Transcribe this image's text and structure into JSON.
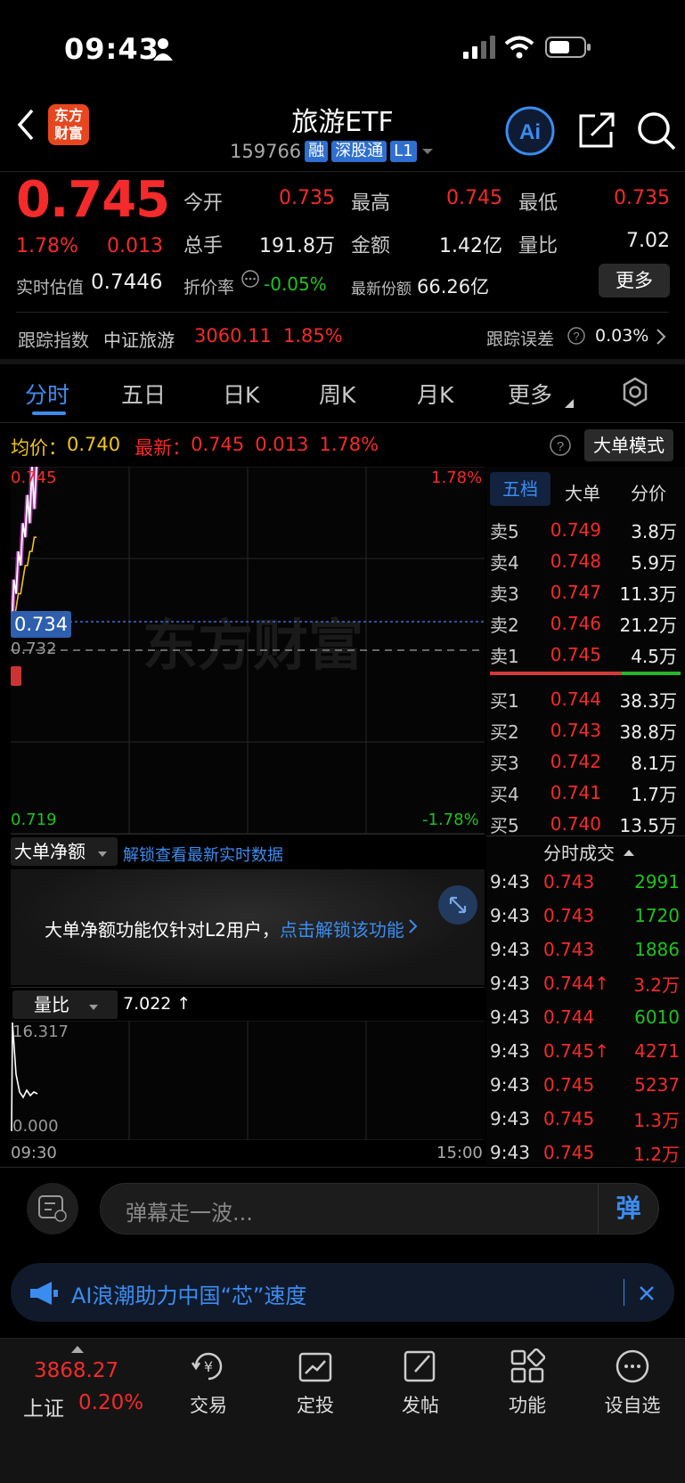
{
  "status": {
    "time": "09:43"
  },
  "header": {
    "title": "旅游ETF",
    "code": "159766",
    "tags": [
      "融",
      "深股通",
      "L1"
    ],
    "logo_text": "东方财富"
  },
  "quote": {
    "price": "0.745",
    "change_pct": "1.78%",
    "change": "0.013",
    "open_label": "今开",
    "open": "0.735",
    "high_label": "最高",
    "high": "0.745",
    "low_label": "最低",
    "low": "0.735",
    "vol_label": "总手",
    "vol": "191.8万",
    "amount_label": "金额",
    "amount": "1.42亿",
    "ratio_label": "量比",
    "ratio": "7.02",
    "iopv_label": "实时估值",
    "iopv": "0.7446",
    "discount_label": "折价率",
    "discount": "-0.05%",
    "shares_label": "最新份额",
    "shares": "66.26亿",
    "more_label": "更多"
  },
  "tracking": {
    "label": "跟踪指数",
    "index_name": "中证旅游",
    "index_value": "3060.11",
    "index_pct": "1.85%",
    "error_label": "跟踪误差",
    "error_value": "0.03%"
  },
  "tabs": [
    "分时",
    "五日",
    "日K",
    "周K",
    "月K",
    "更多"
  ],
  "chart_header": {
    "avg_label": "均价：",
    "avg": "0.740",
    "latest_label": "最新：",
    "latest": "0.745",
    "latest_chg": "0.013",
    "latest_pct": "1.78%",
    "mode_button": "大单模式"
  },
  "chart_data": {
    "type": "line",
    "y_top": "0.745",
    "y_top_pct": "1.78%",
    "y_bottom": "0.719",
    "y_bottom_pct": "-1.78%",
    "cursor_value": "0.734",
    "prev_close": "0.732",
    "x_start": "09:30",
    "x_end": "15:00",
    "ylim": [
      0.719,
      0.745
    ],
    "series": [
      {
        "values": [
          0.733,
          0.737,
          0.736,
          0.739,
          0.738,
          0.741,
          0.74,
          0.743,
          0.741,
          0.745,
          0.742,
          0.745
        ]
      },
      {
        "values": [
          0.733,
          0.734,
          0.735,
          0.736,
          0.736,
          0.737,
          0.738,
          0.738,
          0.739,
          0.739,
          0.74,
          0.74
        ]
      }
    ],
    "watermark": "东方财富"
  },
  "orderbook": {
    "tabs": [
      "五档",
      "大单",
      "分价"
    ],
    "sell": [
      {
        "label": "卖5",
        "price": "0.749",
        "vol": "3.8万"
      },
      {
        "label": "卖4",
        "price": "0.748",
        "vol": "5.9万"
      },
      {
        "label": "卖3",
        "price": "0.747",
        "vol": "11.3万"
      },
      {
        "label": "卖2",
        "price": "0.746",
        "vol": "21.2万"
      },
      {
        "label": "卖1",
        "price": "0.745",
        "vol": "4.5万"
      }
    ],
    "buy": [
      {
        "label": "买1",
        "price": "0.744",
        "vol": "38.3万"
      },
      {
        "label": "买2",
        "price": "0.743",
        "vol": "38.8万"
      },
      {
        "label": "买3",
        "price": "0.742",
        "vol": "8.1万"
      },
      {
        "label": "买4",
        "price": "0.741",
        "vol": "1.7万"
      },
      {
        "label": "买5",
        "price": "0.740",
        "vol": "13.5万"
      }
    ]
  },
  "trades": {
    "title": "分时成交",
    "rows": [
      {
        "t": "9:43",
        "p": "0.743",
        "v": "2991",
        "c": "#1ec31e"
      },
      {
        "t": "9:43",
        "p": "0.743",
        "v": "1720",
        "c": "#1ec31e"
      },
      {
        "t": "9:43",
        "p": "0.743",
        "v": "1886",
        "c": "#1ec31e"
      },
      {
        "t": "9:43",
        "p": "0.744↑",
        "v": "3.2万",
        "c": "#f52a2a"
      },
      {
        "t": "9:43",
        "p": "0.744",
        "v": "6010",
        "c": "#1ec31e"
      },
      {
        "t": "9:43",
        "p": "0.745↑",
        "v": "4271",
        "c": "#f52a2a"
      },
      {
        "t": "9:43",
        "p": "0.745",
        "v": "5237",
        "c": "#f52a2a"
      },
      {
        "t": "9:43",
        "p": "0.745",
        "v": "1.3万",
        "c": "#f52a2a"
      },
      {
        "t": "9:43",
        "p": "0.745",
        "v": "1.2万",
        "c": "#f52a2a"
      }
    ]
  },
  "big_order": {
    "dropdown": "大单净额",
    "unlock_link": "解锁查看最新实时数据",
    "notice": "大单净额功能仅针对L2用户，",
    "notice_link": "点击解锁该功能"
  },
  "volume_ratio": {
    "dropdown": "量比",
    "value": "7.022 ↑",
    "top": "16.317",
    "bottom": "0.000"
  },
  "danmu": {
    "placeholder": "弹幕走一波...",
    "send": "弹"
  },
  "banner": {
    "text": "AI浪潮助力中国“芯”速度"
  },
  "bottom_nav": {
    "index_value": "3868.27",
    "index_name": "上证",
    "index_pct": "0.20%",
    "items": [
      "交易",
      "定投",
      "发帖",
      "功能",
      "设自选"
    ]
  },
  "colors": {
    "up": "#f52a2a",
    "down": "#1ec31e",
    "accent": "#3b8cf0"
  }
}
